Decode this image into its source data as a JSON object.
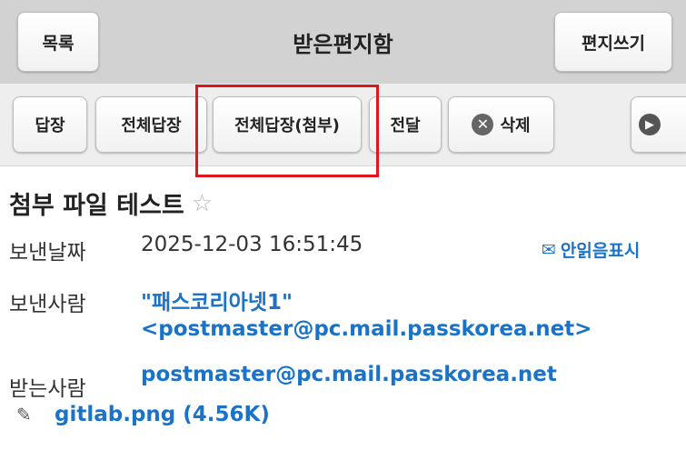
{
  "header": {
    "list_label": "목록",
    "title": "받은편지함",
    "write_label": "편지쓰기"
  },
  "toolbar": {
    "reply_label": "답장",
    "reply_all_label": "전체답장",
    "reply_all_attach_label": "전체답장(첨부)",
    "forward_label": "전달",
    "delete_label": "삭제",
    "delete_icon": "x-circle-icon",
    "more_icon": "chevron-right-circle-icon"
  },
  "message": {
    "subject": "첨부 파일 테스트",
    "star_icon": "star-outline-icon",
    "date_label": "보낸날짜",
    "date_value": "2025-12-03 16:51:45",
    "mark_unread_label": "안읽음표시",
    "sender_label": "보낸사람",
    "sender_name": "\"패스코리아넷1\"",
    "sender_email": "<postmaster@pc.mail.passkorea.net>",
    "recipient_label": "받는사람",
    "recipient": "postmaster@pc.mail.passkorea.net",
    "attachment_icon": "paperclip-icon",
    "attachment_name": "gitlab.png (4.56K)"
  },
  "colors": {
    "accent": "#1a73c8",
    "highlight": "#e0161e",
    "header_bg": "#d2d2d2",
    "toolbar_bg": "#eeeeee"
  }
}
